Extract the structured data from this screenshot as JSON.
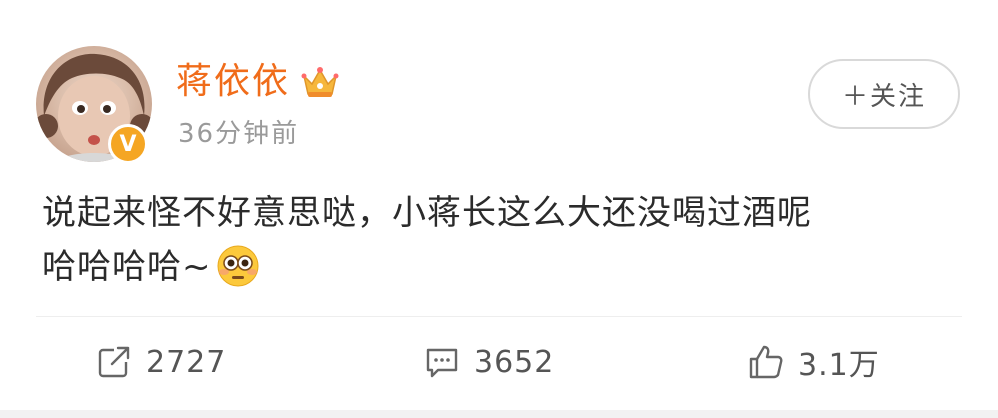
{
  "post": {
    "author": {
      "name": "蒋依依",
      "avatar_icon": "avatar-girl",
      "verified_badge": "V",
      "verified_color": "#f5a623",
      "crown_icon": "crown-icon"
    },
    "timestamp": "36分钟前",
    "follow_label": "＋关注",
    "text_lines": [
      "说起来怪不好意思哒，小蒋长这么大还没喝过酒呢",
      "哈哈哈哈~"
    ],
    "emoji": "flushed-face",
    "actions": {
      "share": {
        "icon": "share-icon",
        "count": "2727"
      },
      "comment": {
        "icon": "comment-icon",
        "count": "3652"
      },
      "like": {
        "icon": "thumbs-up-icon",
        "count": "3.1万"
      }
    }
  },
  "colors": {
    "username": "#f06c1a",
    "meta": "#9a9a9a",
    "text": "#2b2b2b"
  }
}
